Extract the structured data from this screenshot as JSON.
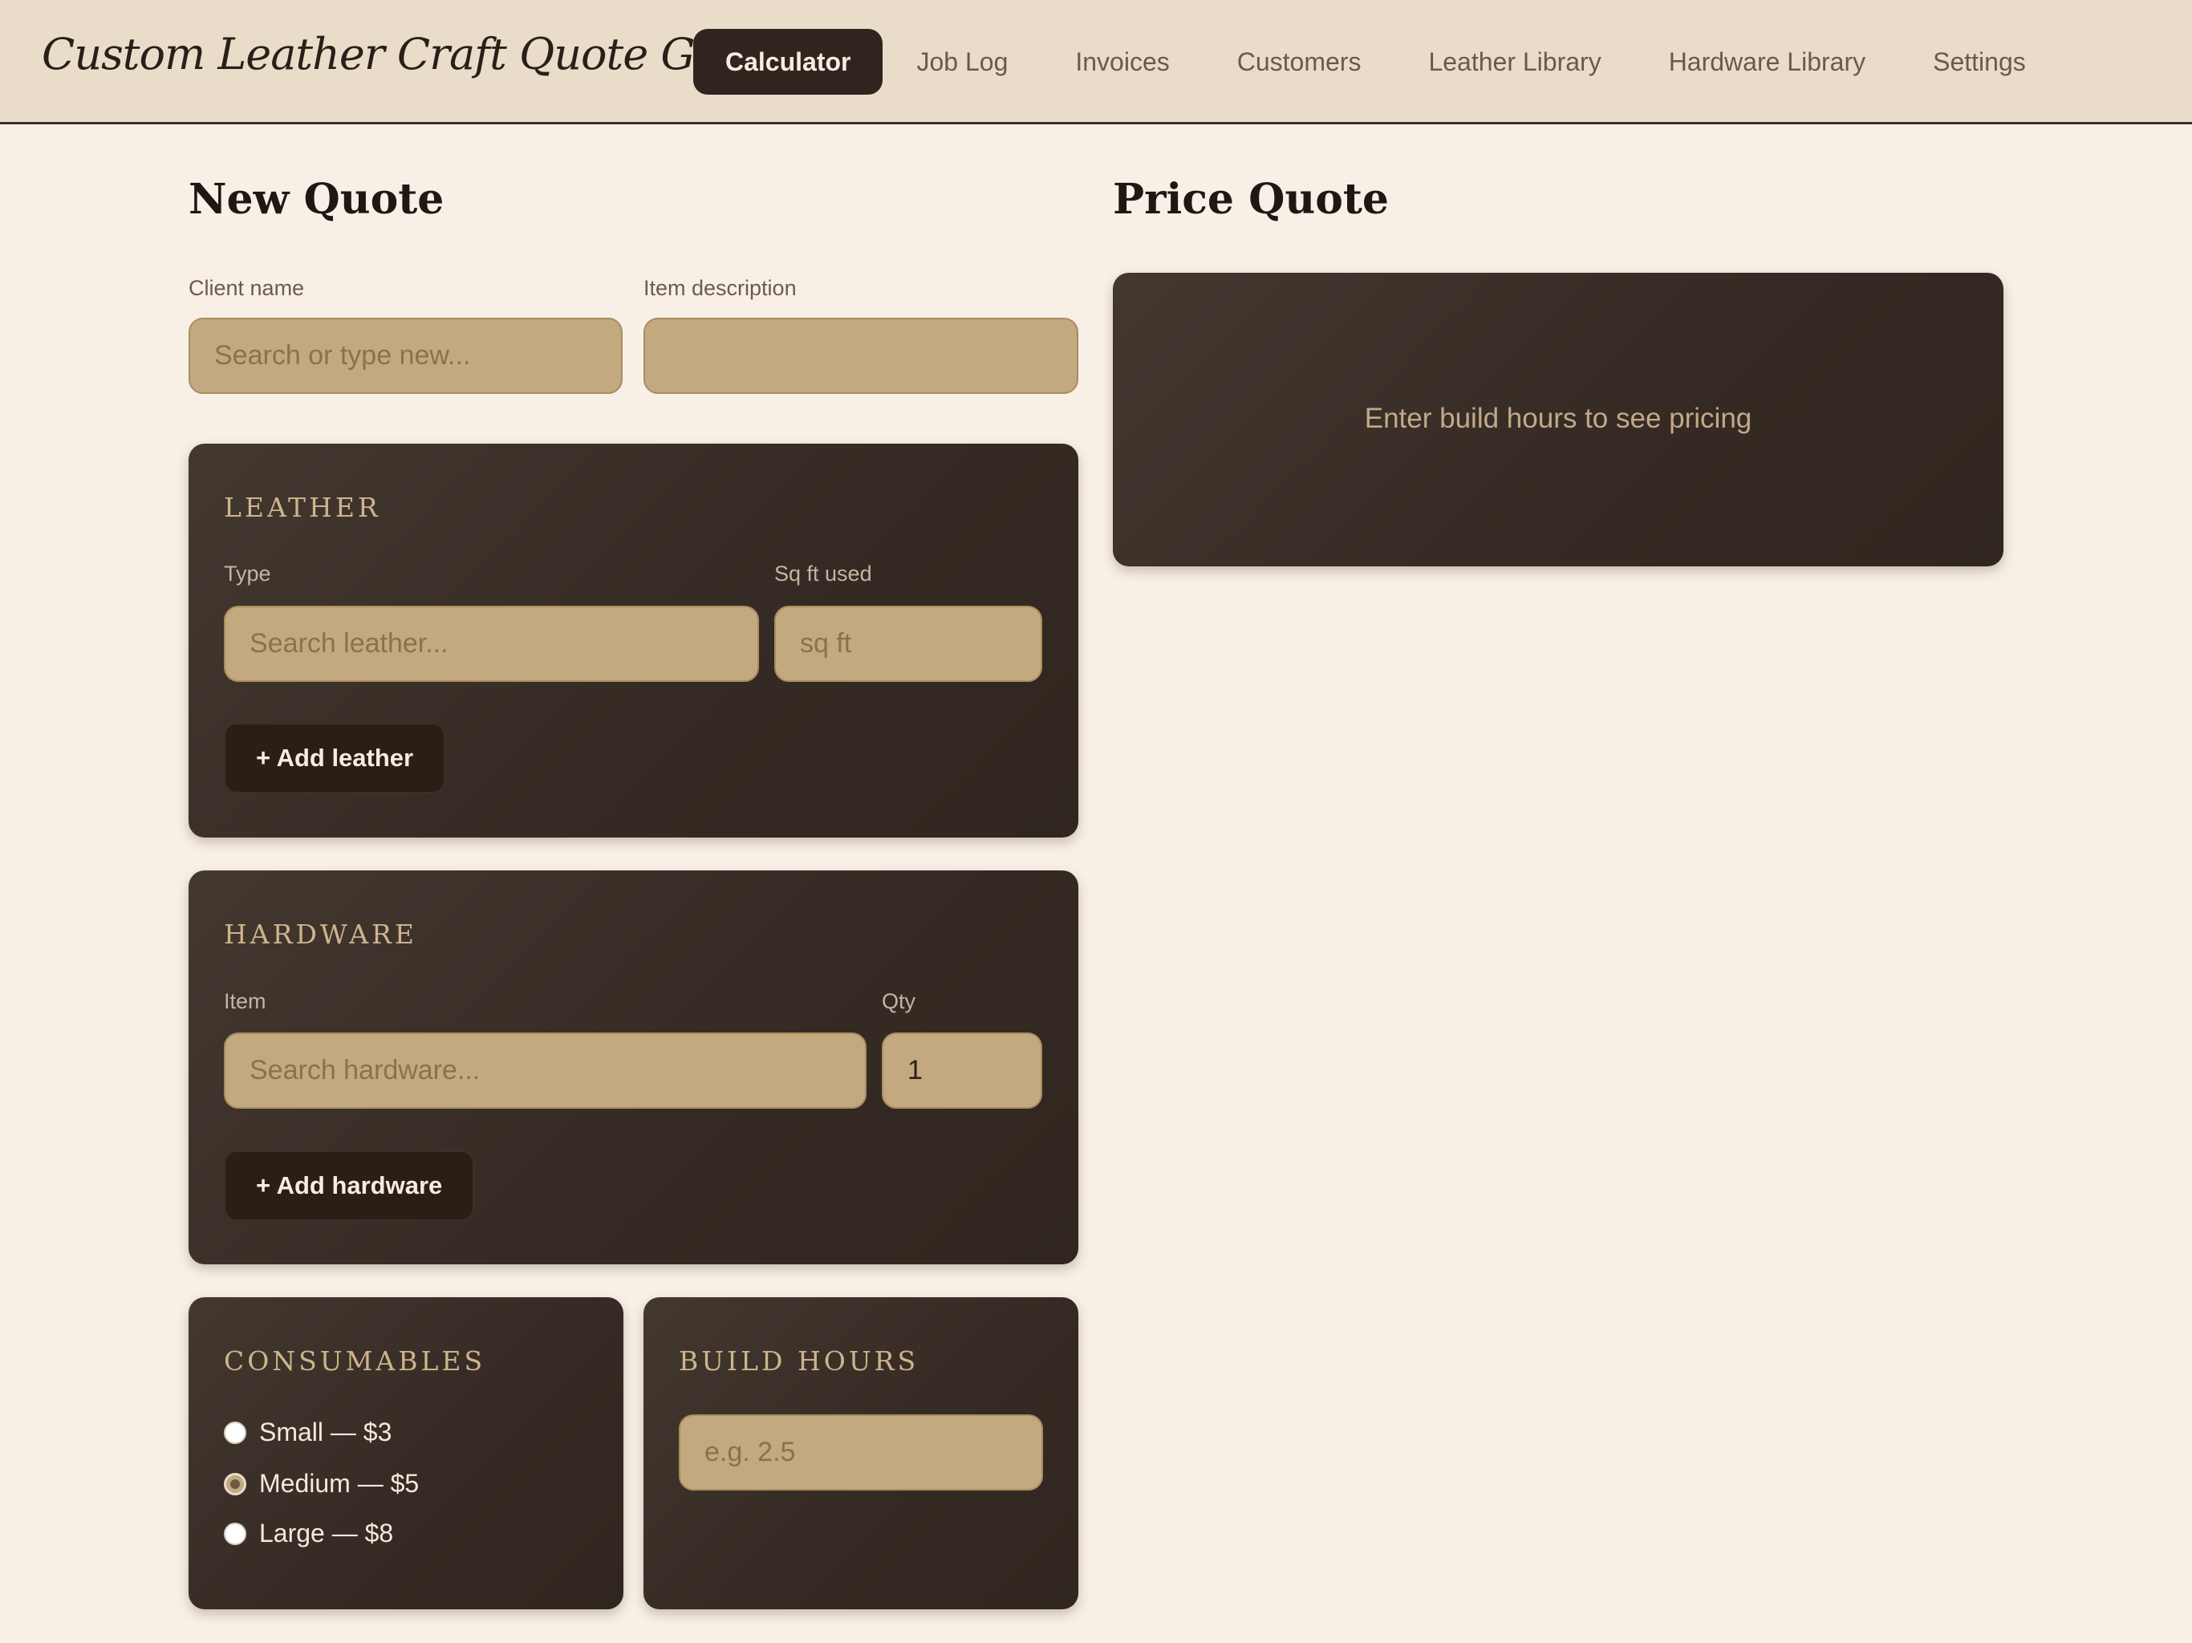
{
  "app": {
    "title": "Custom Leather Craft Quote Generator"
  },
  "nav": {
    "items": [
      {
        "label": "Calculator",
        "active": true
      },
      {
        "label": "Job Log"
      },
      {
        "label": "Invoices"
      },
      {
        "label": "Customers"
      },
      {
        "label": "Leather Library"
      },
      {
        "label": "Hardware Library"
      },
      {
        "label": "Settings"
      }
    ]
  },
  "new_quote": {
    "heading": "New Quote",
    "client_label": "Client name",
    "client_placeholder": "Search or type new...",
    "client_value": "",
    "item_label": "Item description",
    "item_value": ""
  },
  "leather": {
    "title": "LEATHER",
    "type_label": "Type",
    "type_placeholder": "Search leather...",
    "sqft_label": "Sq ft used",
    "sqft_placeholder": "sq ft",
    "add_label": "+ Add leather"
  },
  "hardware": {
    "title": "HARDWARE",
    "item_label": "Item",
    "item_placeholder": "Search hardware...",
    "qty_label": "Qty",
    "qty_value": "1",
    "add_label": "+ Add hardware"
  },
  "consumables": {
    "title": "CONSUMABLES",
    "options": [
      {
        "label": "Small — $3",
        "checked": false
      },
      {
        "label": "Medium — $5",
        "checked": true
      },
      {
        "label": "Large — $8",
        "checked": false
      }
    ]
  },
  "build_hours": {
    "title": "BUILD HOURS",
    "placeholder": "e.g. 2.5"
  },
  "price_quote": {
    "heading": "Price Quote",
    "empty_message": "Enter build hours to see pricing"
  },
  "colors": {
    "background": "#f8f0e6",
    "topbar": "#e9dcc9",
    "card": "#3a2f27",
    "input": "#c2a97f",
    "accent_text": "#cdb48d"
  }
}
